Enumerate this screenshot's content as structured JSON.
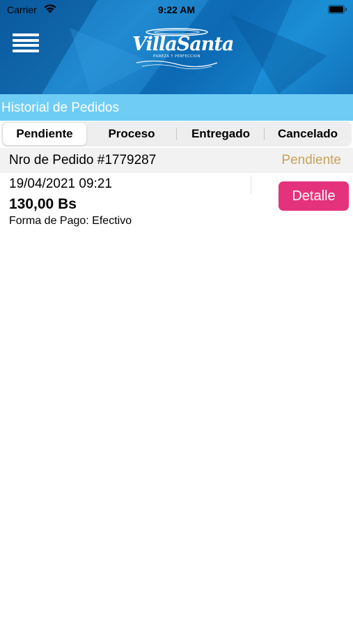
{
  "status_bar": {
    "carrier": "Carrier",
    "time": "9:22 AM"
  },
  "header": {
    "logo": {
      "name": "VillaSanta",
      "tagline": "PUREZA Y PERFECCION"
    },
    "menu_icon": "hamburger-menu-icon"
  },
  "page_title": "Historial de Pedidos",
  "tabs": [
    {
      "label": "Pendiente",
      "active": true
    },
    {
      "label": "Proceso",
      "active": false
    },
    {
      "label": "Entregado",
      "active": false
    },
    {
      "label": "Cancelado",
      "active": false
    }
  ],
  "orders": [
    {
      "number": "Nro de Pedido #1779287",
      "status": "Pendiente",
      "date": "19/04/2021 09:21",
      "total": "130,00 Bs",
      "payment": "Forma de Pago: Efectivo",
      "detail_label": "Detalle"
    }
  ],
  "colors": {
    "header_blue": "#0e6fb8",
    "title_bar": "#6fcdf5",
    "status_pending": "#c9a15a",
    "detail_button": "#e5327c"
  }
}
